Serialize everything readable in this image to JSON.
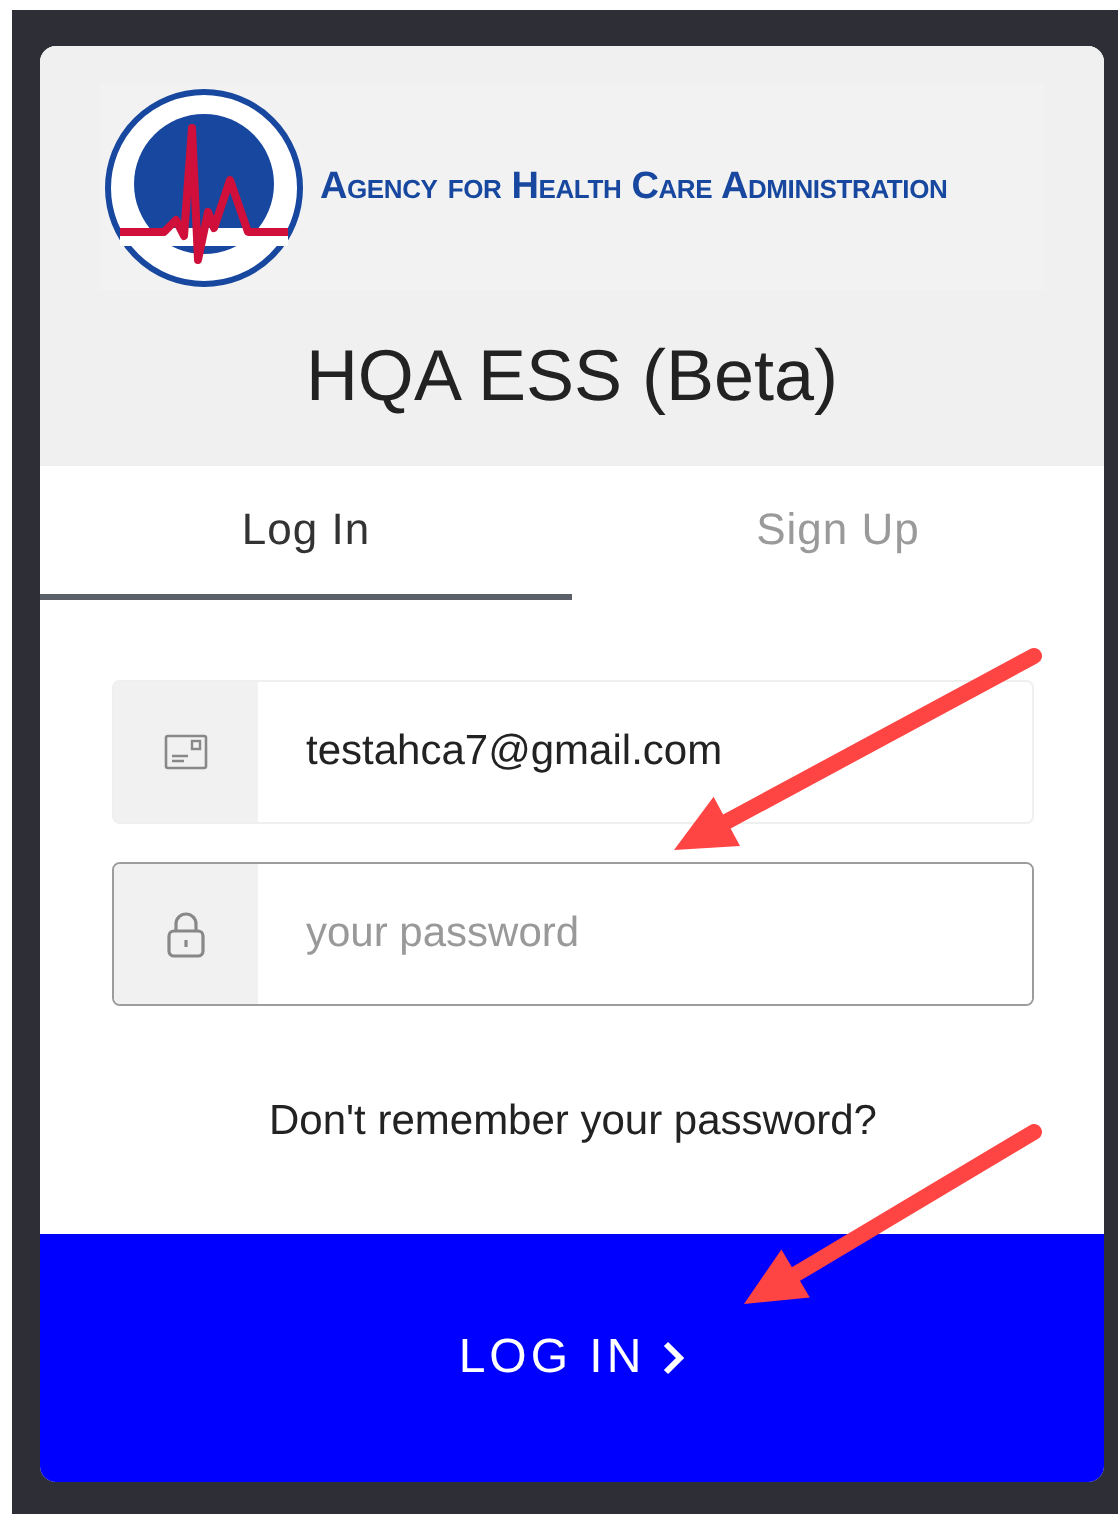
{
  "logo": {
    "name": "Agency for Health Care Administration"
  },
  "title": "HQA ESS (Beta)",
  "tabs": [
    {
      "label": "Log In",
      "selected": true
    },
    {
      "label": "Sign Up",
      "selected": false
    }
  ],
  "fields": [
    {
      "kind": "email",
      "value": "testahca7@gmail.com",
      "focused": false
    },
    {
      "kind": "password",
      "placeholder": "your password",
      "focused": true
    }
  ],
  "forgot_link": "Don't remember your password?",
  "submit_button": "LOG IN"
}
